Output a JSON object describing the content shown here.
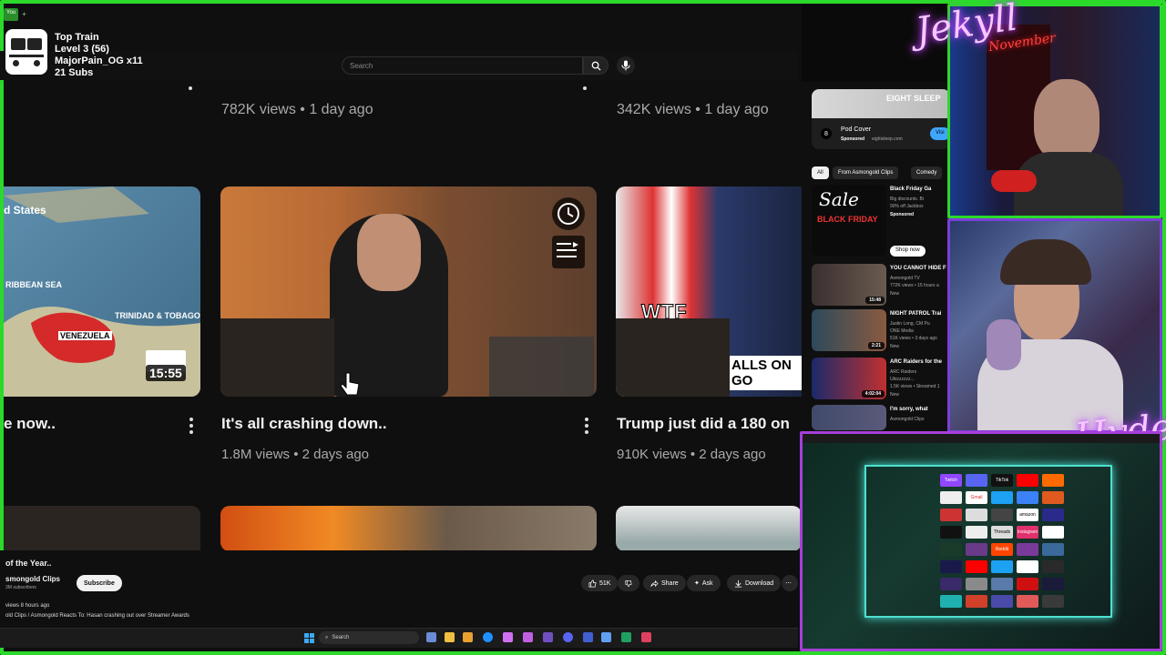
{
  "browser": {
    "tab_label": "You"
  },
  "overlay": {
    "line1": "Top Train",
    "line2": "Level 3  (56)",
    "line3": "MajorPain_OG x11",
    "line4": "21 Subs"
  },
  "search": {
    "placeholder": "Search"
  },
  "row0": {
    "left_meta": "782K views • 1 day ago",
    "right_meta": "342K views • 1 day ago"
  },
  "videos": [
    {
      "title": "e now..",
      "views": "",
      "duration": "15:55",
      "thumb_text": [
        "d States",
        "RIBBEAN SEA",
        "TRINIDAD & TOBAGO",
        "VENEZUELA"
      ]
    },
    {
      "title": "It's all crashing down..",
      "views": "1.8M views • 2 days ago"
    },
    {
      "title": "Trump just did a 180 on",
      "views": "910K views • 2 days ago",
      "thumb_text": [
        "WTF",
        "ALLS ON GO"
      ]
    }
  ],
  "current_video": {
    "title": "of the Year..",
    "channel": "smongold Clips",
    "subs": "3M subscribers",
    "subscribe_label": "Subscribe",
    "likes": "51K",
    "share_label": "Share",
    "ask_label": "Ask",
    "download_label": "Download",
    "desc_line1": "views  8 hours ago",
    "desc_line2": "old Clips / Asmongold Reacts To: Hasan crashing out over Streamer Awards"
  },
  "taskbar": {
    "search_label": "Search"
  },
  "sidebar": {
    "ad": {
      "brand": "EIGHT SLEEP",
      "title": "Pod Cover",
      "sponsor": "Sponsored",
      "domain": "eightsleep.com",
      "cta": "Visi"
    },
    "chips": [
      "All",
      "From Asmongold Clips",
      "Comedy"
    ],
    "recs": [
      {
        "title": "Black Friday Ga",
        "line2": "Big discounts. Bi",
        "line3": "90% off Jackbox",
        "line4": "Sponsored",
        "thumb_text": "Sale",
        "thumb_sub": "BLACK FRIDAY",
        "cta": "Shop now"
      },
      {
        "title": "YOU CANNOT HIDE F",
        "line2": "Asmongold TV",
        "line3": "772K views • 15 hours a",
        "line4": "New",
        "duration": "15:48"
      },
      {
        "title": "NIGHT PATROL Trai",
        "line2": "Justin Long, CM Pu",
        "line3": "ONE Media",
        "line4": "51K views • 3 days ago",
        "line5": "New",
        "duration": "2:21"
      },
      {
        "title": "ARC Raiders for the",
        "line2": "ARC Raiders",
        "line3": "Ubizzzzzz...",
        "line4": "1.5K views • Streamed 1",
        "line5": "New",
        "duration": "4:02:04"
      },
      {
        "title": "I'm sorry, what",
        "line2": "Asmongold Clips"
      }
    ]
  },
  "cams": {
    "top_name": "Jekyll",
    "bottom_name": "Hyde",
    "neon_sign": "November"
  },
  "desktop_tiles": [
    "Twitch",
    "",
    "TikTok",
    "Gmail",
    "",
    "",
    "amazon",
    "",
    "Threads",
    "",
    "Instagram",
    "",
    "",
    "Reddit",
    "",
    "",
    "",
    ""
  ],
  "colors": {
    "frame_green": "#2bd92b",
    "frame_purple": "#a63fd9",
    "yt_bg": "#0f0f0f"
  }
}
